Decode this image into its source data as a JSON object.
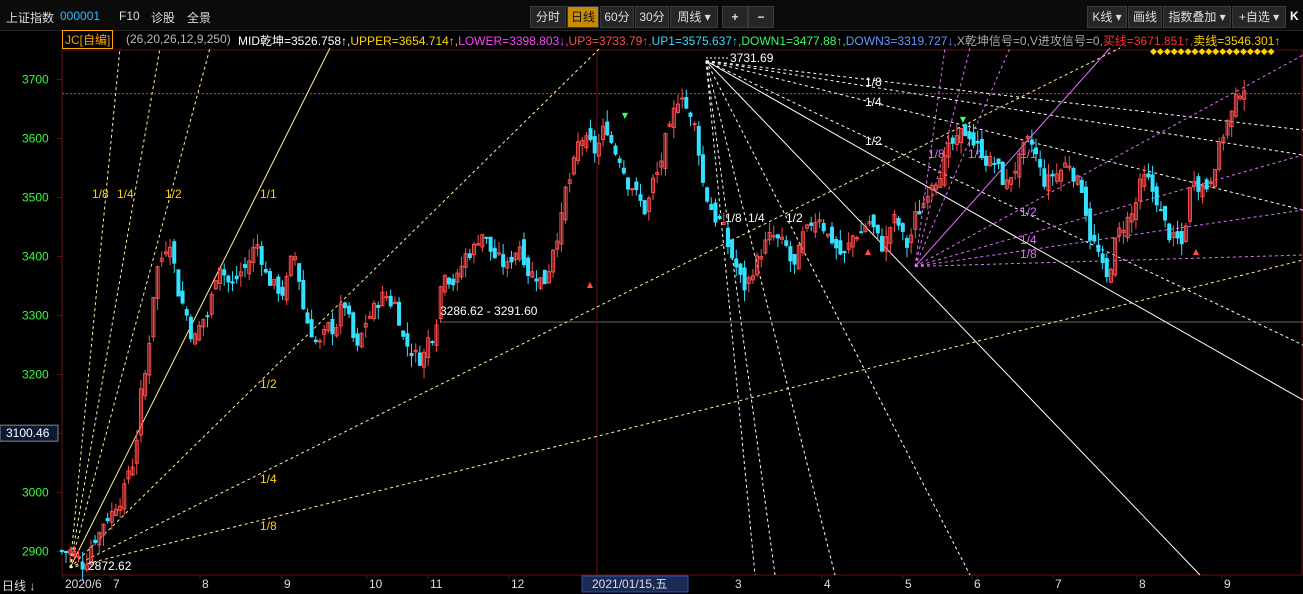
{
  "topbar": {
    "index_name": "上证指数",
    "index_code": "000001",
    "f10": "F10",
    "diagnose": "诊股",
    "fullscreen": "全景",
    "periods": [
      "分时",
      "日线",
      "60分",
      "30分"
    ],
    "selected_period": "日线",
    "week_select": "周线 ▾",
    "zoom_in": "+",
    "zoom_out": "−",
    "kline_select": "K线 ▾",
    "draw": "画线",
    "overlay_select": "指数叠加 ▾",
    "watchlist_select": "+自选 ▾",
    "logo_fragment": "K"
  },
  "indicator": {
    "name": "JC[自编]",
    "params": "(26,20,26,12,9,250)",
    "items": [
      {
        "text": "MID乾坤=3526.758↑,",
        "color": "#ffffff"
      },
      {
        "text": "UPPER=3654.714↑,",
        "color": "#ffd400"
      },
      {
        "text": "LOWER=3398.803↓,",
        "color": "#ff44ff"
      },
      {
        "text": "UP3=3733.79↑,",
        "color": "#ff5050"
      },
      {
        "text": "UP1=3575.637↑,",
        "color": "#33ddff"
      },
      {
        "text": "DOWN1=3477.88↑,",
        "color": "#33ff66"
      },
      {
        "text": "DOWN3=3319.727↓,",
        "color": "#6699ff"
      },
      {
        "text": "X乾坤信号=0,",
        "color": "#aaaaaa"
      },
      {
        "text": "V进攻信号=0,",
        "color": "#aaaaaa"
      },
      {
        "text": "买线=3671.851↑,",
        "color": "#ff3030"
      },
      {
        "text": "卖线=3546.301↑",
        "color": "#ffd400"
      }
    ]
  },
  "colors": {
    "up": "#ff4d4d",
    "down": "#33e0ff",
    "grid": "#6a1010",
    "yaxis_text": "#33ff33",
    "gann_main": "#fff59a",
    "gann_pink": "#e070ff",
    "price_line": "#ff3030"
  },
  "chart_data": {
    "type": "candlestick",
    "title": "上证指数 日线",
    "ylim": [
      2860,
      3750
    ],
    "y_ticks": [
      2900,
      3000,
      3100,
      3200,
      3300,
      3400,
      3500,
      3600,
      3700
    ],
    "x_ticks": [
      "2020/6",
      "7",
      "8",
      "9",
      "10",
      "11",
      "12",
      "2021/01/15,五",
      "3",
      "4",
      "5",
      "6",
      "7",
      "8",
      "9"
    ],
    "cursor_price": "3100.46",
    "current_price_line": 3676,
    "annotations": [
      {
        "text": "3731.69"
      },
      {
        "text": "2872.62"
      },
      {
        "text": "3286.62 - 3291.60"
      }
    ],
    "gann_labels": [
      "1/8",
      "1/4",
      "1/2",
      "1/1",
      "1/2",
      "1/4",
      "1/8"
    ],
    "shown_series": [
      {
        "period": "2020/6",
        "start": 2890
      },
      {
        "period": "2021/02",
        "high": 3731.69
      },
      {
        "period": "2020/6",
        "low": 2872.62
      }
    ],
    "close_path": [
      2900,
      2880,
      2925,
      2960,
      2990,
      3050,
      3200,
      3380,
      3430,
      3320,
      3260,
      3300,
      3390,
      3350,
      3380,
      3420,
      3360,
      3340,
      3400,
      3290,
      3250,
      3280,
      3320,
      3240,
      3300,
      3330,
      3320,
      3250,
      3230,
      3270,
      3380,
      3360,
      3410,
      3440,
      3400,
      3380,
      3420,
      3370,
      3360,
      3440,
      3530,
      3600,
      3580,
      3620,
      3570,
      3520,
      3480,
      3540,
      3610,
      3680,
      3620,
      3500,
      3460,
      3400,
      3350,
      3390,
      3430,
      3420,
      3380,
      3440,
      3470,
      3430,
      3400,
      3440,
      3460,
      3420,
      3460,
      3420,
      3480,
      3530,
      3560,
      3590,
      3610,
      3580,
      3560,
      3520,
      3560,
      3590,
      3530,
      3540,
      3560,
      3520,
      3420,
      3360,
      3440,
      3470,
      3530,
      3500,
      3440,
      3420,
      3540,
      3520,
      3580,
      3640,
      3690
    ]
  },
  "bottom_left": "日线"
}
